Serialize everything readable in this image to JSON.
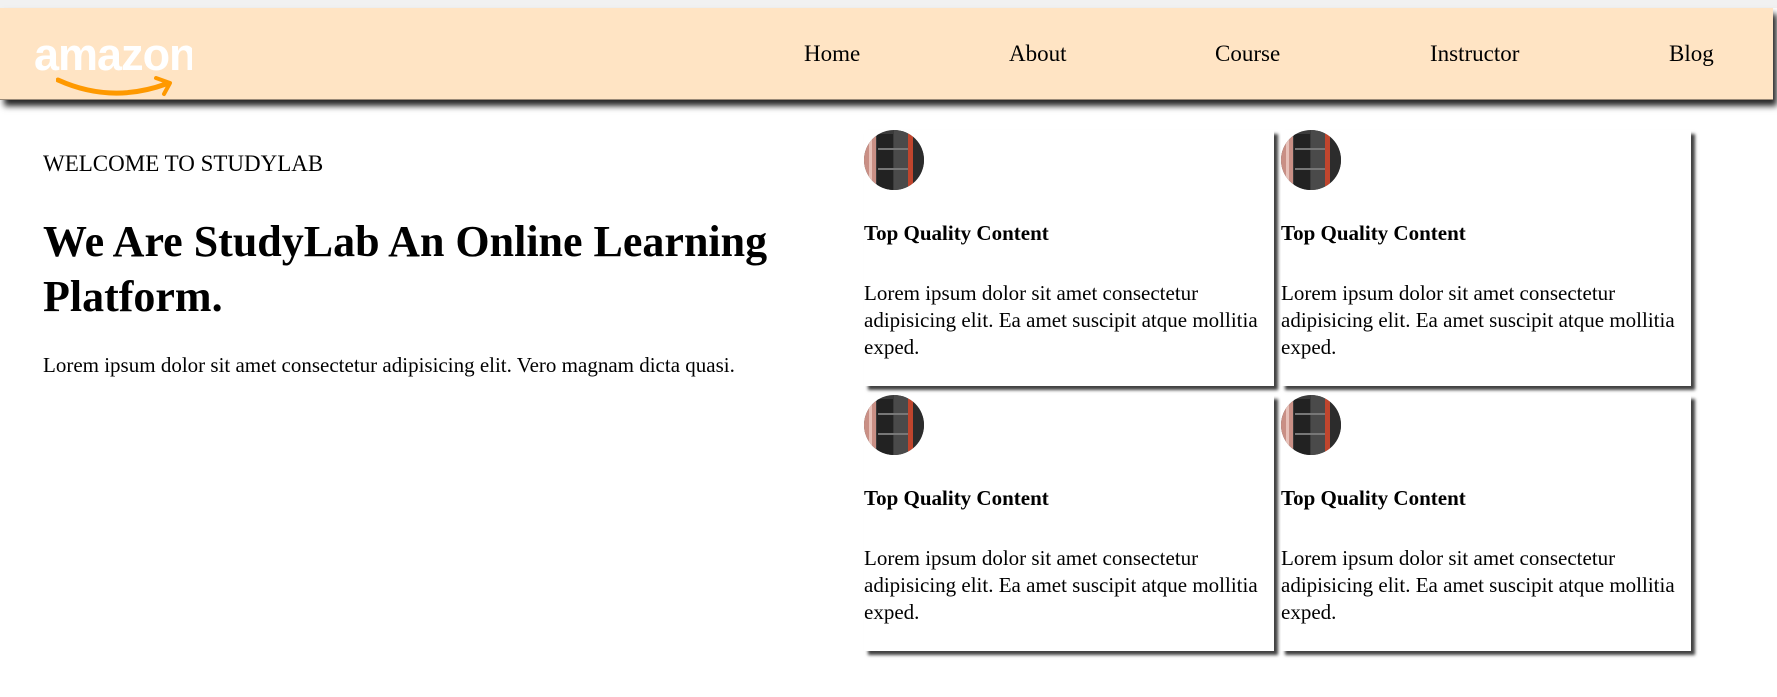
{
  "brand": {
    "logo_text": "amazon",
    "colors": {
      "nav_background": "#ffe4c4",
      "logo_text": "#ffffff",
      "logo_smile": "#ff9900"
    }
  },
  "nav": {
    "items": [
      {
        "label": "Home"
      },
      {
        "label": "About"
      },
      {
        "label": "Course"
      },
      {
        "label": "Instructor"
      },
      {
        "label": "Blog"
      }
    ]
  },
  "hero": {
    "eyebrow": "WELCOME TO STUDYLAB",
    "headline": "We Are StudyLab An Online Learning Platform.",
    "description": "Lorem ipsum dolor sit amet consectetur adipisicing elit. Vero magnam dicta quasi."
  },
  "features": [
    {
      "icon": "feature-photo-icon",
      "title": "Top Quality Content",
      "text": "Lorem ipsum dolor sit amet consectetur adipisicing elit. Ea amet suscipit atque mollitia exped."
    },
    {
      "icon": "feature-photo-icon",
      "title": "Top Quality Content",
      "text": "Lorem ipsum dolor sit amet consectetur adipisicing elit. Ea amet suscipit atque mollitia exped."
    },
    {
      "icon": "feature-photo-icon",
      "title": "Top Quality Content",
      "text": "Lorem ipsum dolor sit amet consectetur adipisicing elit. Ea amet suscipit atque mollitia exped."
    },
    {
      "icon": "feature-photo-icon",
      "title": "Top Quality Content",
      "text": "Lorem ipsum dolor sit amet consectetur adipisicing elit. Ea amet suscipit atque mollitia exped."
    }
  ]
}
